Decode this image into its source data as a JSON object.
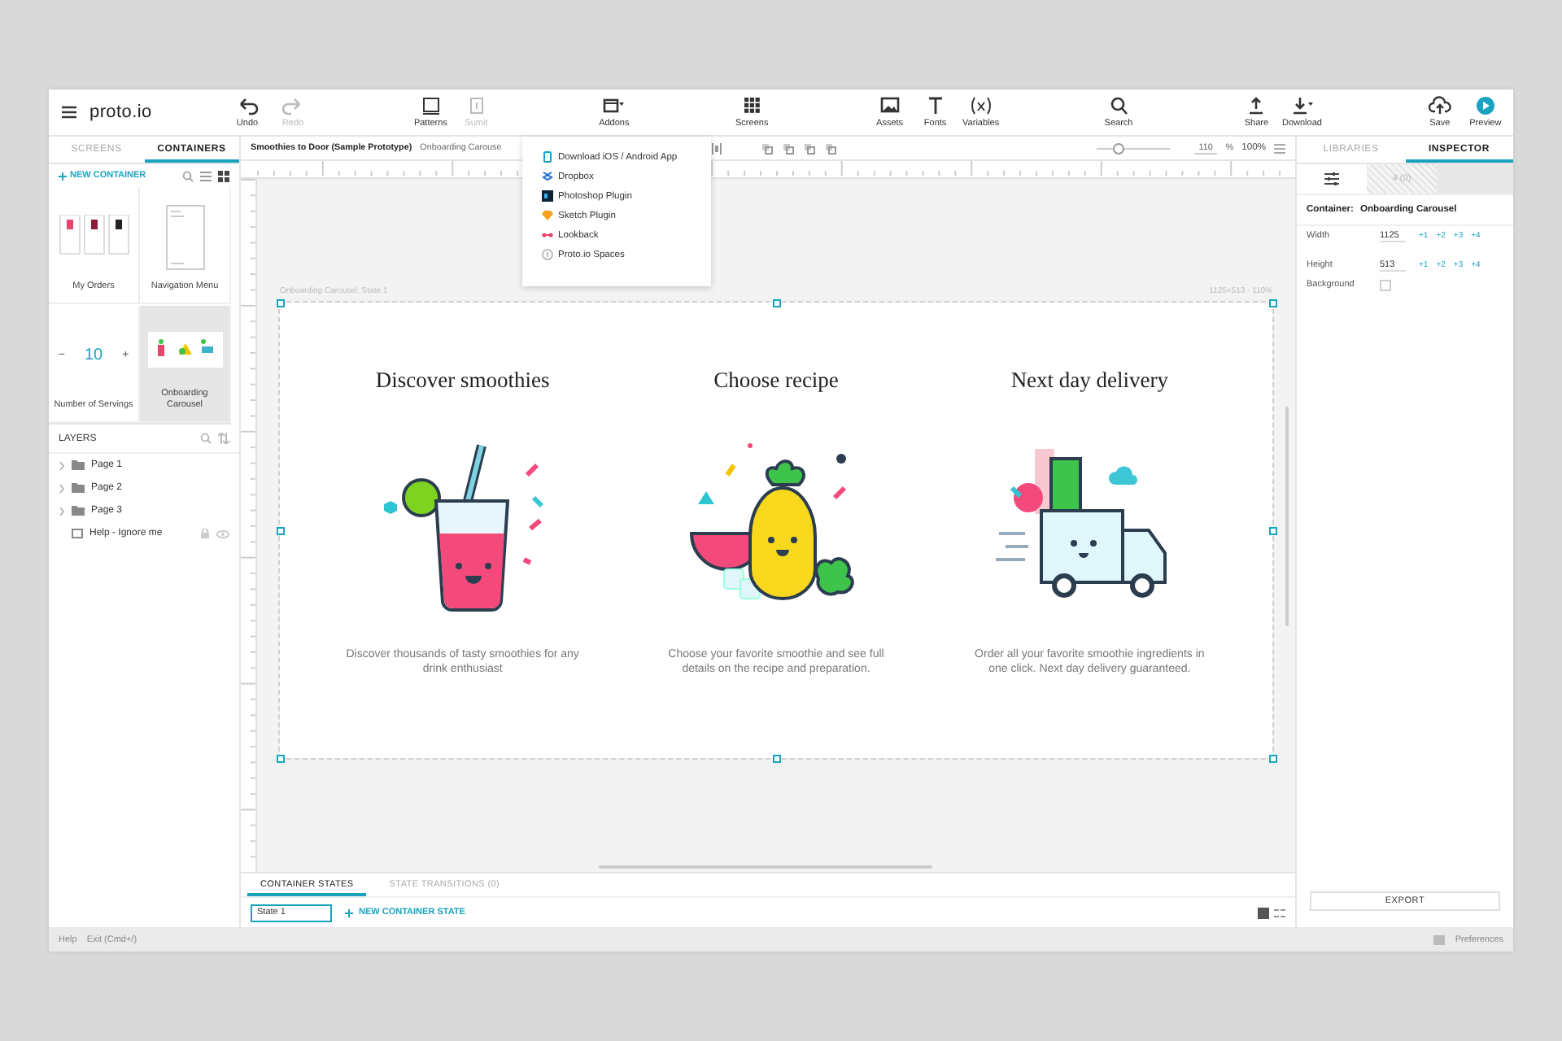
{
  "toolbar": {
    "logo": "proto.io",
    "groups": [
      [
        {
          "label": "Undo",
          "kind": "undo",
          "disabled": false
        },
        {
          "label": "Redo",
          "kind": "redo",
          "disabled": true
        }
      ],
      [
        {
          "label": "Patterns",
          "kind": "patterns",
          "disabled": false
        },
        {
          "label": "Sumit",
          "kind": "bracket",
          "disabled": true
        }
      ],
      [
        {
          "label": "Addons",
          "kind": "addons",
          "disabled": false
        }
      ],
      [
        {
          "label": "Screens",
          "kind": "screens",
          "disabled": false
        }
      ],
      [
        {
          "label": "Assets",
          "kind": "image",
          "disabled": false
        },
        {
          "label": "Fonts",
          "kind": "fonts",
          "disabled": false
        },
        {
          "label": "Variables",
          "kind": "variables",
          "disabled": false
        }
      ],
      [
        {
          "label": "Search",
          "kind": "search",
          "disabled": false
        }
      ],
      [
        {
          "label": "Share",
          "kind": "share",
          "disabled": false
        },
        {
          "label": "Download",
          "kind": "download",
          "disabled": false
        }
      ],
      [
        {
          "label": "Save",
          "kind": "save",
          "disabled": false
        },
        {
          "label": "Preview",
          "kind": "preview",
          "disabled": false
        }
      ]
    ]
  },
  "addons_menu": {
    "items": [
      {
        "label": "Download iOS / Android App",
        "kind": "phone"
      },
      {
        "label": "Dropbox",
        "kind": "dropbox"
      },
      {
        "label": "Photoshop Plugin",
        "kind": "photoshop"
      },
      {
        "label": "Sketch Plugin",
        "kind": "sketch"
      },
      {
        "label": "Lookback",
        "kind": "lookback"
      },
      {
        "label": "Proto.io Spaces",
        "kind": "spaces"
      }
    ]
  },
  "left_panel": {
    "tabs": [
      {
        "label": "SCREENS",
        "selected": false
      },
      {
        "label": "CONTAINERS",
        "selected": true
      }
    ],
    "new_container": "NEW CONTAINER",
    "containers": [
      {
        "name": "My Orders",
        "kind": "orders",
        "selected": false
      },
      {
        "name": "Navigation Menu",
        "kind": "menu",
        "selected": false
      },
      {
        "name": "Number of Servings",
        "kind": "stepper",
        "selected": false,
        "stepper": [
          "−",
          "10",
          "+"
        ]
      },
      {
        "name": "Onboarding Carousel",
        "kind": "carousel",
        "selected": true
      }
    ],
    "layers": {
      "title": "LAYERS",
      "items": [
        {
          "name": "Page 1",
          "kind": "folder",
          "expanded": false
        },
        {
          "name": "Page 2",
          "kind": "folder",
          "expanded": false
        },
        {
          "name": "Page 3",
          "kind": "folder",
          "expanded": false
        },
        {
          "name": "Help - Ignore me",
          "kind": "frame"
        }
      ]
    }
  },
  "editor": {
    "breadcrumb": [
      "Smoothies to Door (Sample Prototype)",
      "Onboarding Carouse"
    ],
    "zoom": {
      "level": 0.3,
      "value": "110",
      "unit": "%",
      "reset": "100%"
    },
    "artboard": {
      "label": "Onboarding Carousel: State 1",
      "size": "1125×513 · 110%",
      "slides": [
        {
          "title": "Discover smoothies",
          "kind": "drink",
          "text": "Discover thousands of tasty smoothies for any drink enthusiast"
        },
        {
          "title": "Choose recipe",
          "kind": "fruit",
          "text": "Choose your favorite smoothie and see full details on the recipe and preparation."
        },
        {
          "title": "Next day delivery",
          "kind": "truck",
          "text": "Order all your favorite smoothie ingredients in one click. Next day delivery guaranteed."
        }
      ]
    },
    "bottom_tabs": [
      {
        "label": "CONTAINER STATES",
        "selected": true
      },
      {
        "label": "STATE TRANSITIONS (0)",
        "selected": false
      }
    ],
    "state_select": "State 1",
    "new_state": "NEW CONTAINER STATE"
  },
  "inspector": {
    "tabs": [
      {
        "label": "LIBRARIES",
        "selected": false
      },
      {
        "label": "INSPECTOR",
        "selected": true
      }
    ],
    "subtabs": [
      {
        "kind": "properties",
        "selected": true
      },
      {
        "kind": "interactions",
        "label": "4 (0)",
        "selected": false
      }
    ],
    "container_label": "Container:",
    "container_name": "Onboarding Carousel",
    "fields": [
      {
        "label": "Width",
        "value": "1125",
        "steps": [
          "+1",
          "+2",
          "+3",
          "+4"
        ]
      },
      {
        "label": "Height",
        "value": "513",
        "steps": [
          "+1",
          "+2",
          "+3",
          "+4"
        ]
      }
    ],
    "background": {
      "label": "Background",
      "checked": false
    },
    "export": "EXPORT"
  },
  "status_bar": {
    "left": [
      "Help",
      "Exit (Cmd+/)"
    ],
    "right": "Preferences"
  }
}
